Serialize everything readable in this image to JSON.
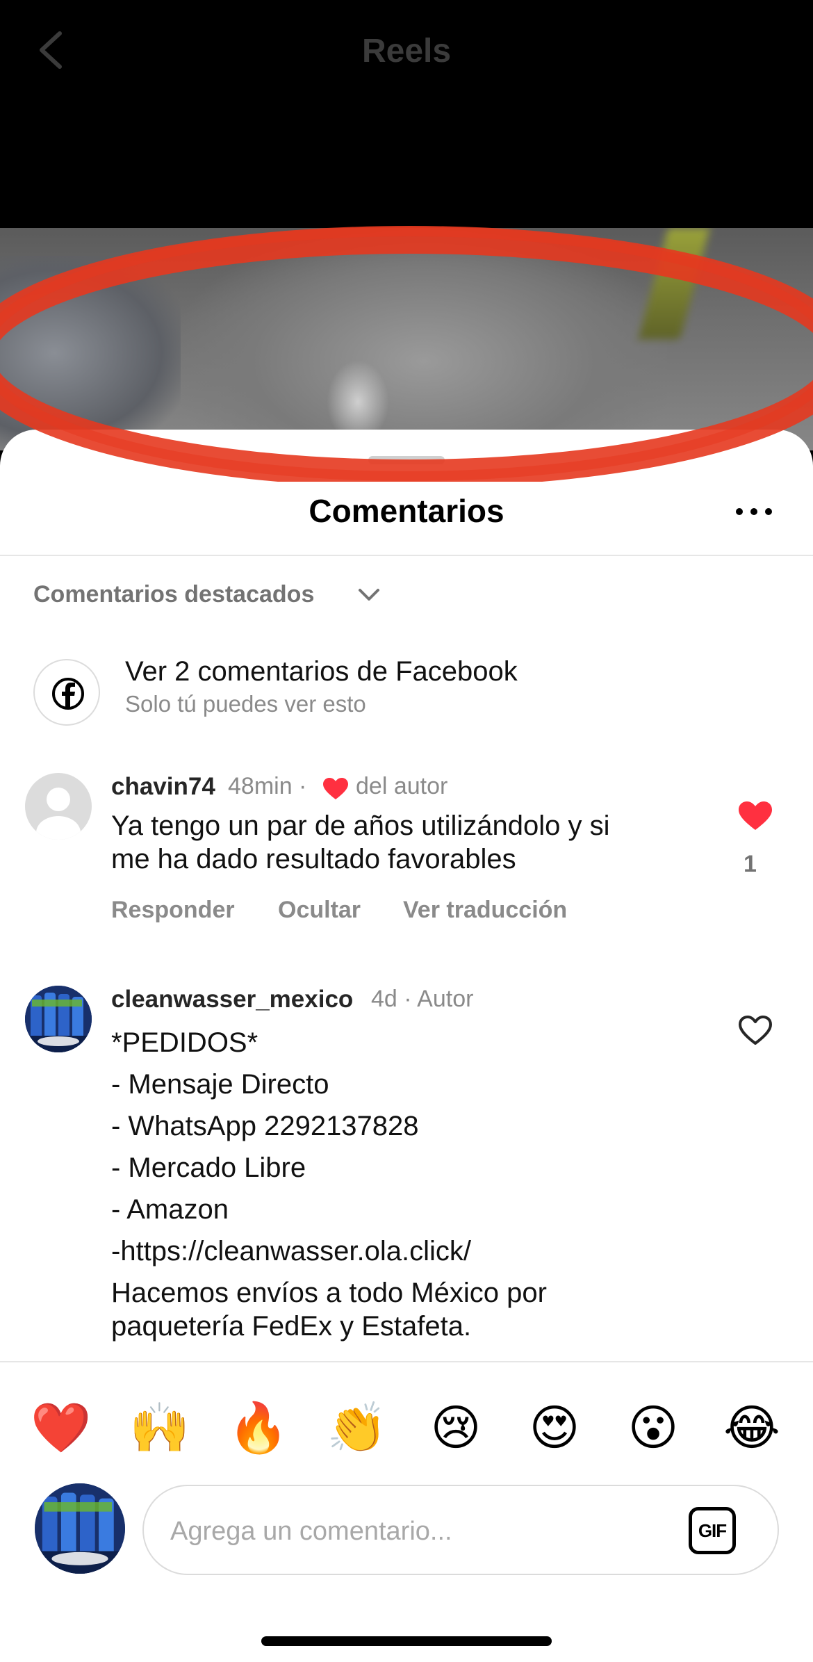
{
  "header": {
    "title": "Reels",
    "back_icon": "chevron-left-icon"
  },
  "sheet": {
    "title": "Comentarios",
    "more_icon": "more-horizontal-icon",
    "filter": {
      "label": "Comentarios destacados",
      "icon": "chevron-down-icon"
    }
  },
  "facebook_row": {
    "icon": "facebook-icon",
    "text": "Ver 2 comentarios de Facebook",
    "subtext": "Solo tú puedes ver esto"
  },
  "comments": [
    {
      "username": "chavin74",
      "time": "48min ·",
      "badge": "del autor",
      "badge_icon": "heart-icon",
      "body_lines": [
        "Ya tengo un par de años utilizándolo y si",
        "me ha dado resultado favorables"
      ],
      "actions": [
        "Responder",
        "Ocultar",
        "Ver traducción"
      ],
      "like_count": "1",
      "liked": true
    },
    {
      "username": "cleanwasser_mexico",
      "time": "4d · Autor",
      "body_lines": [
        "*PEDIDOS*",
        "- Mensaje Directo",
        "- WhatsApp 2292137828",
        "- Mercado Libre",
        "- Amazon",
        "-https://cleanwasser.ola.click/",
        "Hacemos envíos a todo México por",
        "paquetería FedEx y Estafeta."
      ],
      "liked": false
    }
  ],
  "emoji_bar": [
    "❤️",
    "🙌",
    "🔥",
    "👏",
    "😢",
    "😍",
    "😮",
    "😂"
  ],
  "composer": {
    "placeholder": "Agrega un comentario...",
    "gif_label": "GIF"
  },
  "colors": {
    "like_red": "#ff3040",
    "annotation": "#e5391f",
    "muted": "#8a8a8a"
  }
}
